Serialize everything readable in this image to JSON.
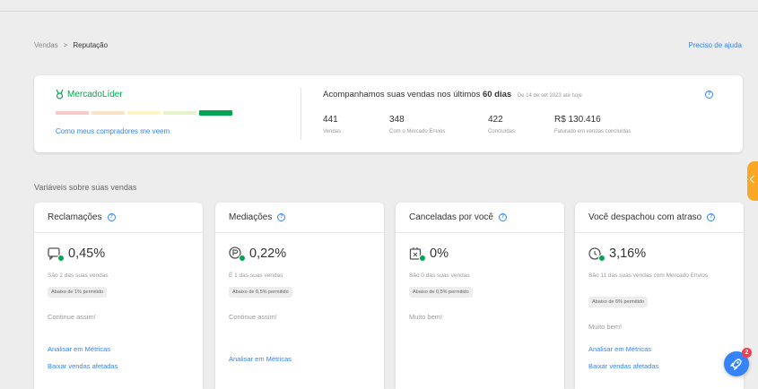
{
  "breadcrumb": {
    "parent": "Vendas",
    "separator": ">",
    "current": "Reputação"
  },
  "help": {
    "label": "Preciso de ajuda"
  },
  "reputation": {
    "badge": "MercadoLíder",
    "thermometer_colors": [
      "#f7c9c9",
      "#fbe2c6",
      "#fdf4c3",
      "#e6f3c9",
      "#00a650"
    ],
    "buyers_link": "Como meus compradores me veem"
  },
  "tracking": {
    "title_prefix": "Acompanhamos suas vendas nos últimos",
    "title_period": "60 dias",
    "since": "De 14 de set 2023 até hoje",
    "info_icon": "info-icon",
    "stats": [
      {
        "value": "441",
        "label": "Vendas"
      },
      {
        "value": "348",
        "label": "Com o Mercado Envios"
      },
      {
        "value": "422",
        "label": "Concluídas"
      },
      {
        "value": "R$ 130.416",
        "label": "Faturado em vendas concluídas"
      }
    ]
  },
  "section": {
    "title": "Variáveis sobre suas vendas"
  },
  "cards": [
    {
      "title": "Reclamações",
      "icon": "chat-check-icon",
      "value": "0,45%",
      "desc": "São 2 das suas vendas",
      "pill": "Abaixo de 1% permitido",
      "status": "Continue assim!",
      "links": [
        "Analisar em Métricas",
        "Baixar vendas afetadas"
      ]
    },
    {
      "title": "Mediações",
      "icon": "mediation-check-icon",
      "value": "0,22%",
      "desc": "É 1 das suas vendas",
      "pill": "Abaixo de 0,5% permitido",
      "status": "Continue assim!",
      "links": [
        "Analisar em Métricas"
      ]
    },
    {
      "title": "Canceladas por você",
      "icon": "cancel-box-check-icon",
      "value": "0%",
      "desc": "São 0 das suas vendas",
      "pill": "Abaixo de 0,5% permitido",
      "status": "Muito bem!",
      "links": []
    },
    {
      "title": "Você despachou com atraso",
      "icon": "clock-check-icon",
      "value": "3,16%",
      "desc": "São 11 das suas vendas com Mercado Envios",
      "pill": "Abaixo de 6% permitido",
      "status": "Muito bem!",
      "links": [
        "Analisar em Métricas",
        "Baixar vendas afetadas"
      ]
    }
  ],
  "widgets": {
    "notification_count": "2"
  },
  "colors": {
    "accent": "#3483fa",
    "success": "#00a650",
    "feedback_tab": "#f9a825",
    "notification": "#f23d4f"
  }
}
